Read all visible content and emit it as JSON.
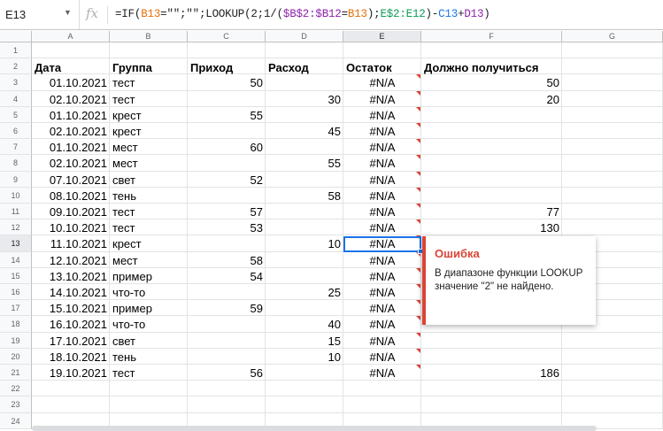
{
  "formula_bar": {
    "cell_ref": "E13",
    "fx_icon": "fx-icon",
    "formula_parts": [
      {
        "t": "=IF(",
        "c": ""
      },
      {
        "t": "B13",
        "c": "ref-orange"
      },
      {
        "t": "=",
        "c": ""
      },
      {
        "t": "\"\"",
        "c": ""
      },
      {
        "t": ";",
        "c": ""
      },
      {
        "t": "\"\"",
        "c": ""
      },
      {
        "t": ";LOOKUP(2;1/(",
        "c": ""
      },
      {
        "t": "$B$2:$B12",
        "c": "ref-purple"
      },
      {
        "t": "=",
        "c": ""
      },
      {
        "t": "B13",
        "c": "ref-orange"
      },
      {
        "t": ");",
        "c": ""
      },
      {
        "t": "E$2:E12",
        "c": "ref-green"
      },
      {
        "t": ")-",
        "c": ""
      },
      {
        "t": "C13",
        "c": "ref-blue"
      },
      {
        "t": "+",
        "c": ""
      },
      {
        "t": "D13",
        "c": "ref-purple"
      },
      {
        "t": ")",
        "c": ""
      }
    ]
  },
  "columns": [
    "A",
    "B",
    "C",
    "D",
    "E",
    "F",
    "G"
  ],
  "selected_column": "E",
  "selected_row": 13,
  "headers_row": [
    "Дата",
    "Группа",
    "Приход",
    "Расход",
    "Остаток",
    "Должно получиться"
  ],
  "rows": [
    {
      "n": 3,
      "date": "01.10.2021",
      "group": "тест",
      "in": "50",
      "out": "",
      "rest": "#N/A",
      "expect": "50"
    },
    {
      "n": 4,
      "date": "02.10.2021",
      "group": "тест",
      "in": "",
      "out": "30",
      "rest": "#N/A",
      "expect": "20"
    },
    {
      "n": 5,
      "date": "01.10.2021",
      "group": "крест",
      "in": "55",
      "out": "",
      "rest": "#N/A",
      "expect": ""
    },
    {
      "n": 6,
      "date": "02.10.2021",
      "group": "крест",
      "in": "",
      "out": "45",
      "rest": "#N/A",
      "expect": ""
    },
    {
      "n": 7,
      "date": "01.10.2021",
      "group": "мест",
      "in": "60",
      "out": "",
      "rest": "#N/A",
      "expect": ""
    },
    {
      "n": 8,
      "date": "02.10.2021",
      "group": "мест",
      "in": "",
      "out": "55",
      "rest": "#N/A",
      "expect": ""
    },
    {
      "n": 9,
      "date": "07.10.2021",
      "group": "свет",
      "in": "52",
      "out": "",
      "rest": "#N/A",
      "expect": ""
    },
    {
      "n": 10,
      "date": "08.10.2021",
      "group": "тень",
      "in": "",
      "out": "58",
      "rest": "#N/A",
      "expect": ""
    },
    {
      "n": 11,
      "date": "09.10.2021",
      "group": "тест",
      "in": "57",
      "out": "",
      "rest": "#N/A",
      "expect": "77"
    },
    {
      "n": 12,
      "date": "10.10.2021",
      "group": "тест",
      "in": "53",
      "out": "",
      "rest": "#N/A",
      "expect": "130"
    },
    {
      "n": 13,
      "date": "11.10.2021",
      "group": "крест",
      "in": "",
      "out": "10",
      "rest": "#N/A",
      "expect": ""
    },
    {
      "n": 14,
      "date": "12.10.2021",
      "group": "мест",
      "in": "58",
      "out": "",
      "rest": "#N/A",
      "expect": ""
    },
    {
      "n": 15,
      "date": "13.10.2021",
      "group": "пример",
      "in": "54",
      "out": "",
      "rest": "#N/A",
      "expect": ""
    },
    {
      "n": 16,
      "date": "14.10.2021",
      "group": "что-то",
      "in": "",
      "out": "25",
      "rest": "#N/A",
      "expect": ""
    },
    {
      "n": 17,
      "date": "15.10.2021",
      "group": "пример",
      "in": "59",
      "out": "",
      "rest": "#N/A",
      "expect": ""
    },
    {
      "n": 18,
      "date": "16.10.2021",
      "group": "что-то",
      "in": "",
      "out": "40",
      "rest": "#N/A",
      "expect": ""
    },
    {
      "n": 19,
      "date": "17.10.2021",
      "group": "свет",
      "in": "",
      "out": "15",
      "rest": "#N/A",
      "expect": ""
    },
    {
      "n": 20,
      "date": "18.10.2021",
      "group": "тень",
      "in": "",
      "out": "10",
      "rest": "#N/A",
      "expect": ""
    },
    {
      "n": 21,
      "date": "19.10.2021",
      "group": "тест",
      "in": "56",
      "out": "",
      "rest": "#N/A",
      "expect": "186"
    }
  ],
  "empty_rows": [
    1,
    22,
    23,
    24
  ],
  "header_row_number": 2,
  "error_popup": {
    "title": "Ошибка",
    "message": "В диапазоне функции LOOKUP значение \"2\" не найдено."
  },
  "colors": {
    "error": "#db4437",
    "selection": "#1a73e8"
  }
}
